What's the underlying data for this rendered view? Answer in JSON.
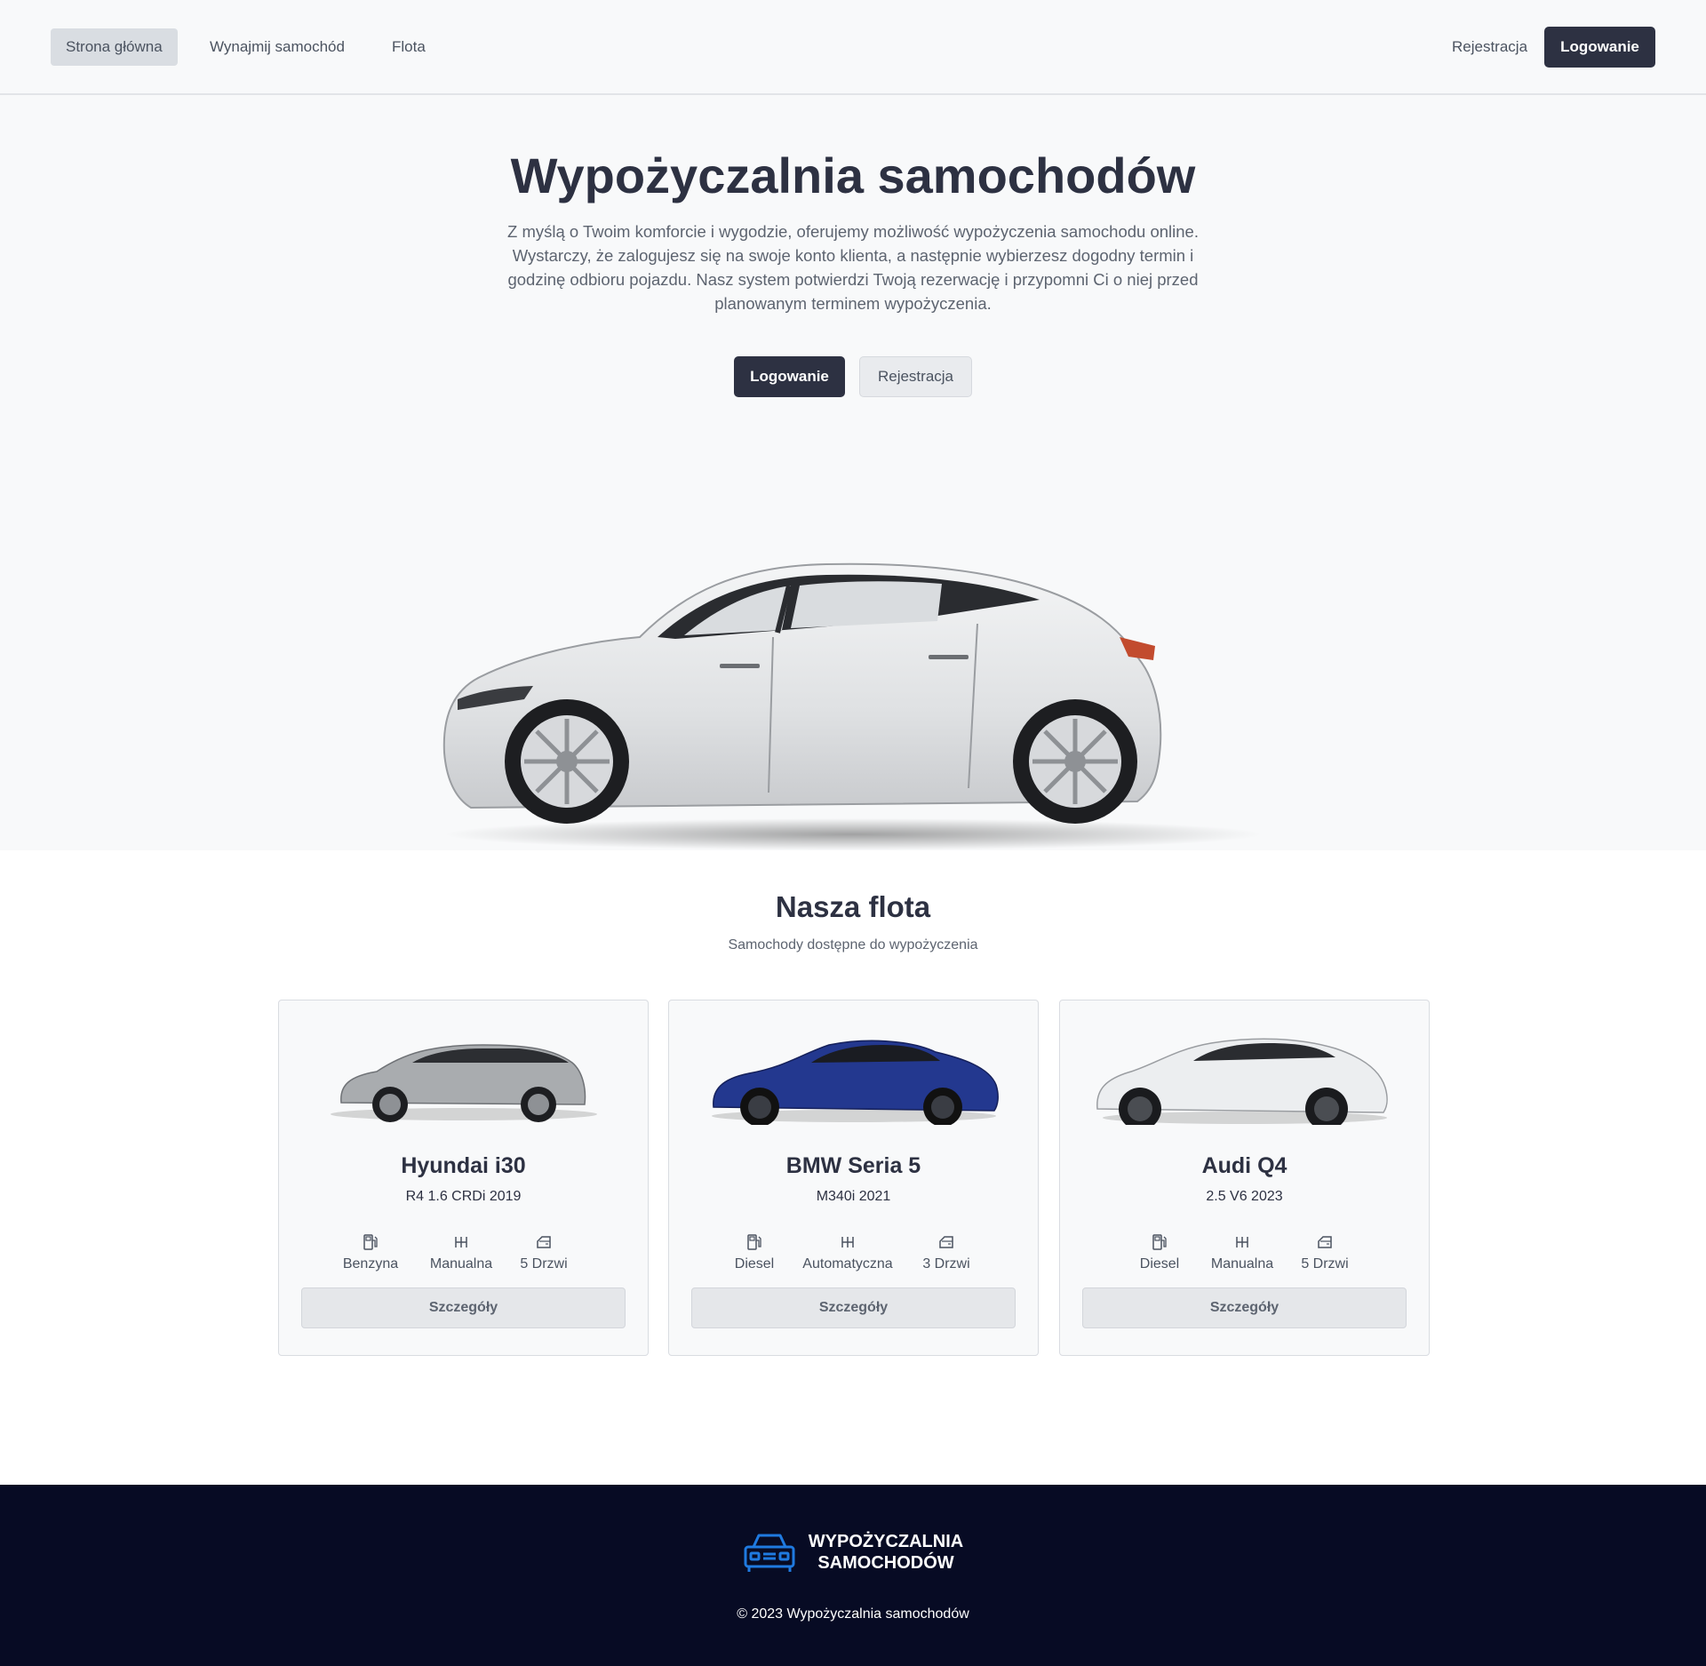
{
  "nav": {
    "links": [
      {
        "label": "Strona główna",
        "active": true
      },
      {
        "label": "Wynajmij samochód",
        "active": false
      },
      {
        "label": "Flota",
        "active": false
      }
    ],
    "register_label": "Rejestracja",
    "login_label": "Logowanie"
  },
  "hero": {
    "title": "Wypożyczalnia samochodów",
    "description": "Z myślą o Twoim komforcie i wygodzie, oferujemy możliwość wypożyczenia samochodu online. Wystarczy, że zalogujesz się na swoje konto klienta, a następnie wybierzesz dogodny termin i godzinę odbioru pojazdu. Nasz system potwierdzi Twoją rezerwację i przypomni Ci o niej przed planowanym terminem wypożyczenia.",
    "login_button": "Logowanie",
    "register_button": "Rejestracja"
  },
  "fleet": {
    "title": "Nasza flota",
    "subtitle": "Samochody dostępne do wypożyczenia",
    "cars": [
      {
        "name": "Hyundai i30",
        "spec": "R4 1.6 CRDi 2019",
        "fuel": "Benzyna",
        "gearbox": "Manualna",
        "doors": "5 Drzwi",
        "details": "Szczegóły",
        "color": "#a9acaf"
      },
      {
        "name": "BMW Seria 5",
        "spec": "M340i 2021",
        "fuel": "Diesel",
        "gearbox": "Automatyczna",
        "doors": "3 Drzwi",
        "details": "Szczegóły",
        "color": "#23388f"
      },
      {
        "name": "Audi Q4",
        "spec": "2.5 V6 2023",
        "fuel": "Diesel",
        "gearbox": "Manualna",
        "doors": "5 Drzwi",
        "details": "Szczegóły",
        "color": "#eceef0"
      }
    ]
  },
  "footer": {
    "brand_line1": "WYPOŻYCZALNIA",
    "brand_line2": "SAMOCHODÓW",
    "copyright": "© 2023 Wypożyczalnia samochodów",
    "icon_color": "#1f7ae0"
  }
}
